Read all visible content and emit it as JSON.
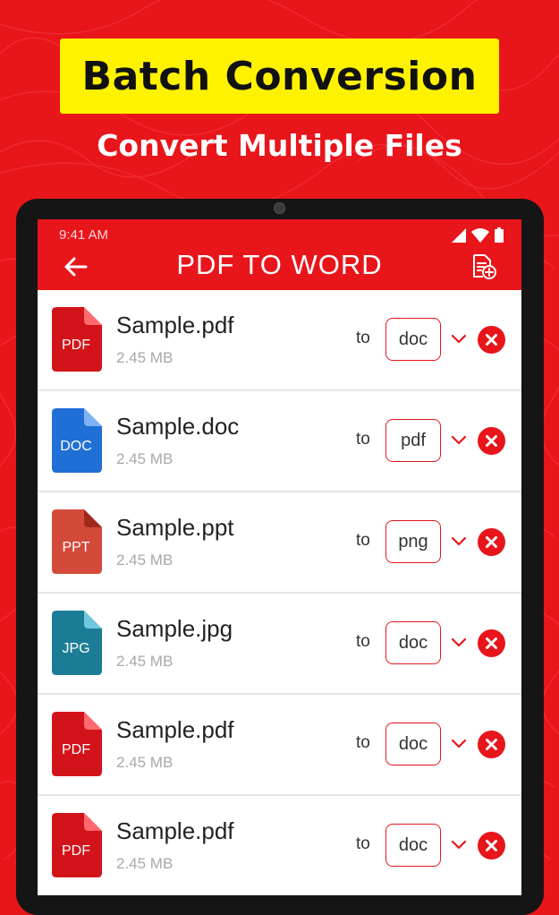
{
  "banner": {
    "title": "Batch Conversion",
    "subtitle": "Convert Multiple Files"
  },
  "status_bar": {
    "time": "9:41 AM"
  },
  "app_bar": {
    "title": "PDF TO WORD",
    "back_icon": "arrow-left-icon",
    "action_icon": "add-file-icon"
  },
  "colors": {
    "accent": "#e8151b",
    "banner": "#fff200",
    "pdf": "#d3131a",
    "doc": "#1f6fd6",
    "ppt": "#d3493a",
    "jpg": "#1a7d95"
  },
  "files": [
    {
      "type": "PDF",
      "name": "Sample.pdf",
      "size": "2.45 MB",
      "to": "to",
      "format": "doc"
    },
    {
      "type": "DOC",
      "name": "Sample.doc",
      "size": "2.45 MB",
      "to": "to",
      "format": "pdf"
    },
    {
      "type": "PPT",
      "name": "Sample.ppt",
      "size": "2.45 MB",
      "to": "to",
      "format": "png"
    },
    {
      "type": "JPG",
      "name": "Sample.jpg",
      "size": "2.45 MB",
      "to": "to",
      "format": "doc"
    },
    {
      "type": "PDF",
      "name": "Sample.pdf",
      "size": "2.45 MB",
      "to": "to",
      "format": "doc"
    },
    {
      "type": "PDF",
      "name": "Sample.pdf",
      "size": "2.45 MB",
      "to": "to",
      "format": "doc"
    }
  ]
}
